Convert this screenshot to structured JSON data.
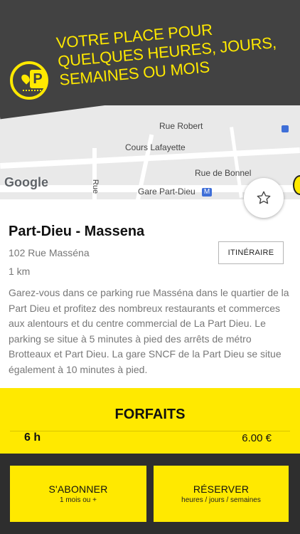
{
  "banner": {
    "lines": [
      "VOTRE PLACE POUR",
      "QUELQUES HEURES, JOURS,",
      "SEMAINES OU MOIS"
    ],
    "logo_letter": "P",
    "accent_color": "#ffe900",
    "background_color": "#424242"
  },
  "map": {
    "labels": {
      "rue_robert": "Rue Robert",
      "cours_lafayette": "Cours Lafayette",
      "rue_de_bonnel": "Rue de Bonnel",
      "gare": "Gare Part-Dieu",
      "side_street": "Rue",
      "google": "Google"
    },
    "metro_icon": "metro-icon"
  },
  "parking": {
    "title": "Part-Dieu - Massena",
    "address": "102 Rue Masséna",
    "distance": "1 km",
    "itinerary_label": "ITINÉRAIRE",
    "description": "Garez-vous dans ce parking rue Masséna dans le quartier de la Part Dieu et profitez des nombreux restaurants et commerces aux alentours et du centre commercial de La Part Dieu. Le parking se situe à 5 minutes à pied des arrêts de métro Brotteaux et Part Dieu. La gare SNCF de la Part Dieu se situe également à 10 minutes à pied.",
    "favorite_icon": "star-outline-icon"
  },
  "forfaits": {
    "title": "FORFAITS",
    "items": [
      {
        "duration": "6 h",
        "price": "6.00 €"
      }
    ]
  },
  "actions": {
    "subscribe": {
      "label": "S'ABONNER",
      "sublabel": "1 mois ou +"
    },
    "reserve": {
      "label": "RÉSERVER",
      "sublabel": "heures / jours / semaines"
    }
  }
}
